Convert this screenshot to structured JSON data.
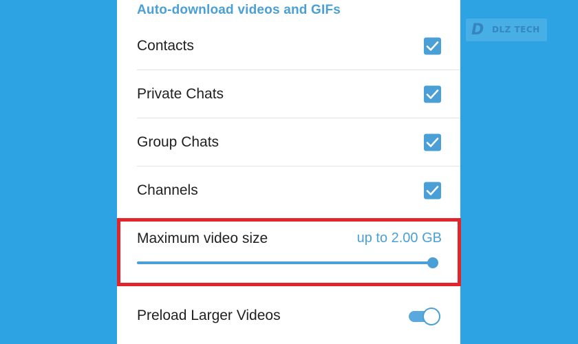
{
  "settings": {
    "section_title": "Auto-download videos and GIFs",
    "items": [
      {
        "label": "Contacts",
        "checked": true
      },
      {
        "label": "Private Chats",
        "checked": true
      },
      {
        "label": "Group Chats",
        "checked": true
      },
      {
        "label": "Channels",
        "checked": true
      }
    ],
    "max_video_size": {
      "label": "Maximum video size",
      "value_text": "up to 2.00 GB",
      "level": 1.0
    },
    "preload": {
      "label": "Preload Larger Videos",
      "enabled": true
    }
  },
  "watermark": {
    "mark": "D",
    "text": "DLZ TECH"
  },
  "colors": {
    "background": "#2ea3e3",
    "accent": "#4a9fd6",
    "highlight_border": "#e2242b"
  }
}
